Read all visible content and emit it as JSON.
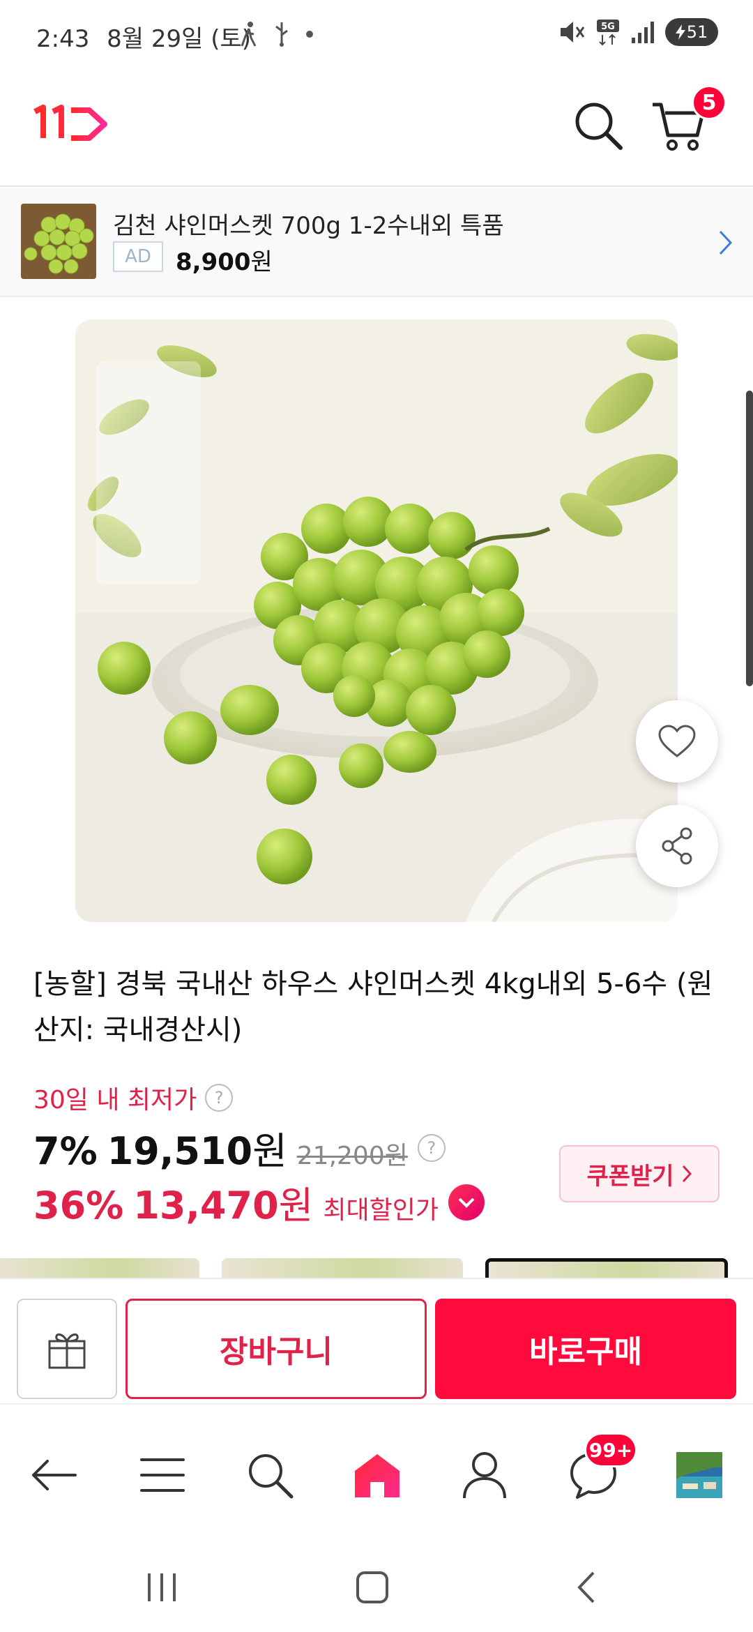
{
  "status_bar": {
    "time": "2:43",
    "date": "8월 29일 (토)",
    "battery": "51"
  },
  "header": {
    "logo_text": "11",
    "cart_count": "5"
  },
  "ad_banner": {
    "title": "김천 샤인머스켓 700g 1-2수내외 특품",
    "label": "AD",
    "price": "8,900",
    "currency": "원"
  },
  "product": {
    "title": "[농할] 경북 국내산 하우스 샤인머스켓 4kg내외 5-6수 (원산지: 국내경산시)",
    "lowest_label": "30일 내 최저가",
    "help_mark": "?",
    "discount_rate": "7%",
    "price": "19,510",
    "currency": "원",
    "original_price": "21,200원",
    "max_discount_rate": "36%",
    "max_price": "13,470",
    "max_label": "최대할인가",
    "coupon_label": "쿠폰받기"
  },
  "actions": {
    "cart_label": "장바구니",
    "buy_label": "바로구매"
  },
  "bottom_nav": {
    "chat_badge": "99+",
    "items": [
      "back-icon",
      "menu-icon",
      "search-icon",
      "home-icon",
      "user-icon",
      "chat-icon",
      "recent-view-thumbnail"
    ]
  },
  "colors": {
    "brand": "#ff0038",
    "price_accent": "#e0214a"
  }
}
